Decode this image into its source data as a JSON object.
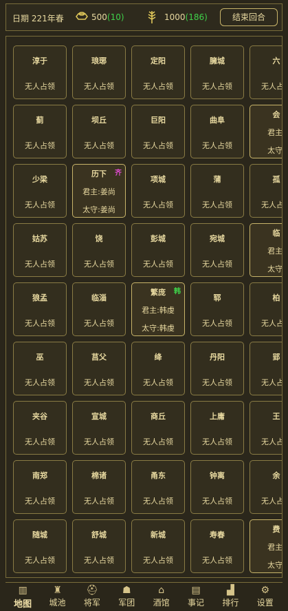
{
  "header": {
    "date": "日期 221年春",
    "gold": "500",
    "gold_delta": "(10)",
    "grain": "1000",
    "grain_delta": "(186)",
    "end_turn": "结束回合"
  },
  "colors": {
    "accent": "#c9b56a",
    "positive": "#3fd24a",
    "tag_qi": "#e04bd0",
    "tag_han": "#3fd24a"
  },
  "status_unoccupied": "无人占领",
  "cities": [
    [
      {
        "name": "淳于"
      },
      {
        "name": "琅琊"
      },
      {
        "name": "定阳"
      },
      {
        "name": "臃城"
      },
      {
        "name": "六"
      }
    ],
    [
      {
        "name": "蓟"
      },
      {
        "name": "坝丘"
      },
      {
        "name": "巨阳"
      },
      {
        "name": "曲阜"
      },
      {
        "name": "会",
        "lord": "君主:",
        "gov": "太守:"
      }
    ],
    [
      {
        "name": "少梁"
      },
      {
        "name": "历下",
        "lord": "君主:姜尚",
        "gov": "太守:姜尚",
        "tag": "齐",
        "tag_color": "#e04bd0"
      },
      {
        "name": "项城"
      },
      {
        "name": "蒲"
      },
      {
        "name": "孤"
      }
    ],
    [
      {
        "name": "姑苏"
      },
      {
        "name": "饶"
      },
      {
        "name": "彭城"
      },
      {
        "name": "宛城"
      },
      {
        "name": "临",
        "lord": "君主:",
        "gov": "太守:"
      }
    ],
    [
      {
        "name": "狼孟"
      },
      {
        "name": "临淄"
      },
      {
        "name": "繁庞",
        "lord": "君主:韩虔",
        "gov": "太守:韩虔",
        "tag": "韩",
        "tag_color": "#3fd24a"
      },
      {
        "name": "郓"
      },
      {
        "name": "柏"
      }
    ],
    [
      {
        "name": "巫"
      },
      {
        "name": "莒父"
      },
      {
        "name": "绛"
      },
      {
        "name": "丹阳"
      },
      {
        "name": "郢"
      }
    ],
    [
      {
        "name": "夹谷"
      },
      {
        "name": "宣城"
      },
      {
        "name": "商丘"
      },
      {
        "name": "上庸"
      },
      {
        "name": "王"
      }
    ],
    [
      {
        "name": "南郑"
      },
      {
        "name": "棉诸"
      },
      {
        "name": "甬东"
      },
      {
        "name": "钟离"
      },
      {
        "name": "余"
      }
    ],
    [
      {
        "name": "随城"
      },
      {
        "name": "舒城"
      },
      {
        "name": "新城"
      },
      {
        "name": "寿春"
      },
      {
        "name": "费",
        "lord": "君主:",
        "gov": "太守:"
      }
    ]
  ],
  "nav": [
    {
      "label": "地图",
      "icon": "map-icon",
      "glyph": "▥",
      "active": true
    },
    {
      "label": "城池",
      "icon": "castle-icon",
      "glyph": "♜"
    },
    {
      "label": "将军",
      "icon": "helmet-icon",
      "glyph": "⛑"
    },
    {
      "label": "军团",
      "icon": "army-icon",
      "glyph": "☗"
    },
    {
      "label": "酒馆",
      "icon": "tavern-icon",
      "glyph": "⌂"
    },
    {
      "label": "事记",
      "icon": "book-icon",
      "glyph": "▤"
    },
    {
      "label": "排行",
      "icon": "ranking-icon",
      "glyph": "▟"
    },
    {
      "label": "设置",
      "icon": "gear-icon",
      "glyph": "⚙"
    }
  ]
}
